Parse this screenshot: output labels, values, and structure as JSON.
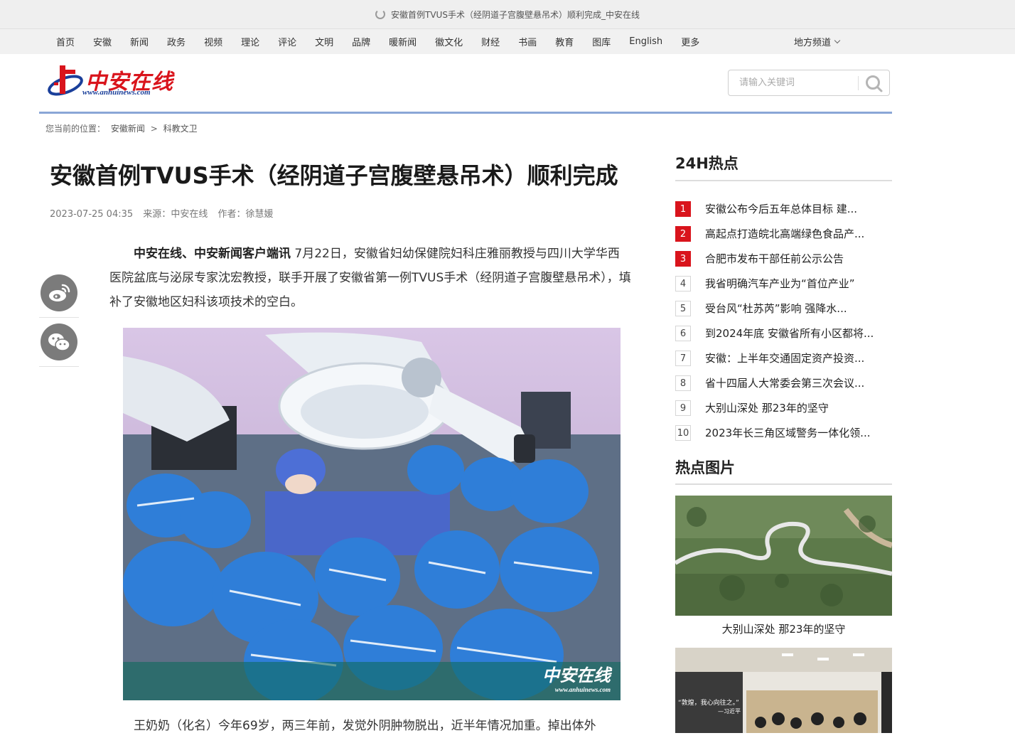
{
  "browser": {
    "tab_title": "安徽首例TVUS手术（经阴道子宫腹壁悬吊术）顺利完成_中安在线"
  },
  "nav": {
    "items": [
      "首页",
      "安徽",
      "新闻",
      "政务",
      "视频",
      "理论",
      "评论",
      "文明",
      "品牌",
      "暖新闻",
      "徽文化",
      "财经",
      "书画",
      "教育",
      "图库",
      "English",
      "更多"
    ],
    "regional": "地方频道"
  },
  "logo": {
    "cn": "中安在线",
    "url": "www.anhuinews.com",
    "brand_color": "#d9141c"
  },
  "search": {
    "placeholder": "请输入关键词"
  },
  "breadcrumb": {
    "label": "您当前的位置：",
    "path": [
      "安徽新闻",
      "科教文卫"
    ],
    "separator": ">"
  },
  "article": {
    "title": "安徽首例TVUS手术（经阴道子宫腹壁悬吊术）顺利完成",
    "date": "2023-07-25 04:35",
    "source_label": "来源：",
    "source": "中安在线",
    "author_label": "作者：",
    "author": "徐慧媛",
    "lead_bold": "中安在线、中安新闻客户端讯",
    "lead_text": " 7月22日，安徽省妇幼保健院妇科庄雅丽教授与四川大学华西医院盆底与泌尿专家沈宏教授，联手开展了安徽省第一例TVUS手术（经阴道子宫腹壁悬吊术），填补了安徽地区妇科该项技术的空白。",
    "photo_watermark_cn": "中安在线",
    "photo_watermark_url": "www.anhuinews.com",
    "para2": "王奶奶（化名）今年69岁，两三年前，发觉外阴肿物脱出，近半年情况加重。掉出体外"
  },
  "sidebar": {
    "hot_title": "24H热点",
    "hot_items": [
      {
        "rank": "1",
        "text": "安徽公布今后五年总体目标 建..."
      },
      {
        "rank": "2",
        "text": "高起点打造皖北高端绿色食品产..."
      },
      {
        "rank": "3",
        "text": "合肥市发布干部任前公示公告"
      },
      {
        "rank": "4",
        "text": "我省明确汽车产业为“首位产业”"
      },
      {
        "rank": "5",
        "text": "受台风“杜苏芮”影响 强降水..."
      },
      {
        "rank": "6",
        "text": "到2024年底 安徽省所有小区都将..."
      },
      {
        "rank": "7",
        "text": "安徽：上半年交通固定资产投资..."
      },
      {
        "rank": "8",
        "text": "省十四届人大常委会第三次会议..."
      },
      {
        "rank": "9",
        "text": "大别山深处 那23年的坚守"
      },
      {
        "rank": "10",
        "text": "2023年长三角区域警务一体化领..."
      }
    ],
    "pic_title": "热点图片",
    "pics": [
      {
        "caption": "大别山深处 那23年的坚守"
      },
      {
        "banner_text": "“敦煌，我心向往之。”",
        "banner_sub": "—习近平"
      }
    ]
  }
}
